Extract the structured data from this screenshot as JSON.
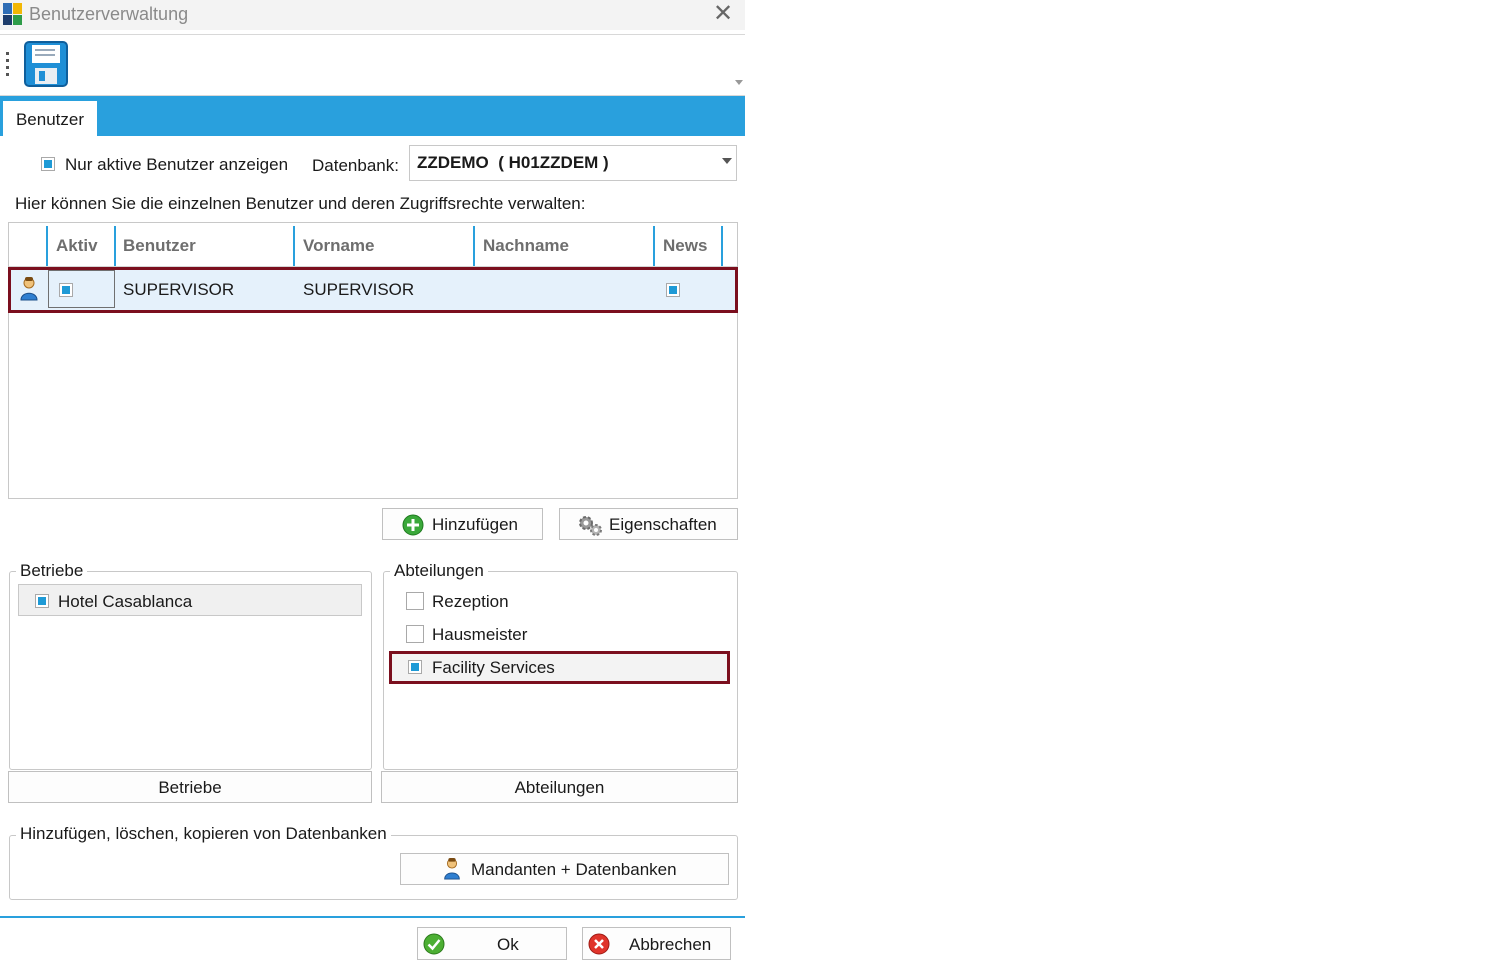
{
  "window": {
    "title": "Benutzerverwaltung"
  },
  "toolbar": {
    "save_icon": "floppy-disk-icon"
  },
  "tabs": [
    {
      "label": "Benutzer"
    }
  ],
  "filter": {
    "active_only_label": "Nur aktive Benutzer anzeigen",
    "active_only_checked": true,
    "db_label": "Datenbank:",
    "db_value": "ZZDEMO  ( H01ZZDEM )"
  },
  "description": "Hier können Sie die einzelnen Benutzer und deren Zugriffsrechte verwalten:",
  "users_table": {
    "columns": [
      "Aktiv",
      "Benutzer",
      "Vorname",
      "Nachname",
      "News"
    ],
    "rows": [
      {
        "aktiv": true,
        "benutzer": "SUPERVISOR",
        "vorname": "SUPERVISOR",
        "nachname": "",
        "news": true
      }
    ]
  },
  "actions": {
    "add": "Hinzufügen",
    "properties": "Eigenschaften"
  },
  "betriebe": {
    "legend": "Betriebe",
    "items": [
      {
        "label": "Hotel Casablanca",
        "checked": true
      }
    ],
    "button": "Betriebe"
  },
  "abteilungen": {
    "legend": "Abteilungen",
    "items": [
      {
        "label": "Rezeption",
        "checked": false
      },
      {
        "label": "Hausmeister",
        "checked": false
      },
      {
        "label": "Facility Services",
        "checked": true
      }
    ],
    "button": "Abteilungen"
  },
  "datenbanken": {
    "legend": "Hinzufügen, löschen, kopieren von Datenbanken",
    "button": "Mandanten + Datenbanken"
  },
  "footer": {
    "ok": "Ok",
    "cancel": "Abbrechen"
  },
  "colors": {
    "accent": "#29a0dd",
    "highlight": "#7b0f1e",
    "row_selected": "#e5f1fb"
  }
}
